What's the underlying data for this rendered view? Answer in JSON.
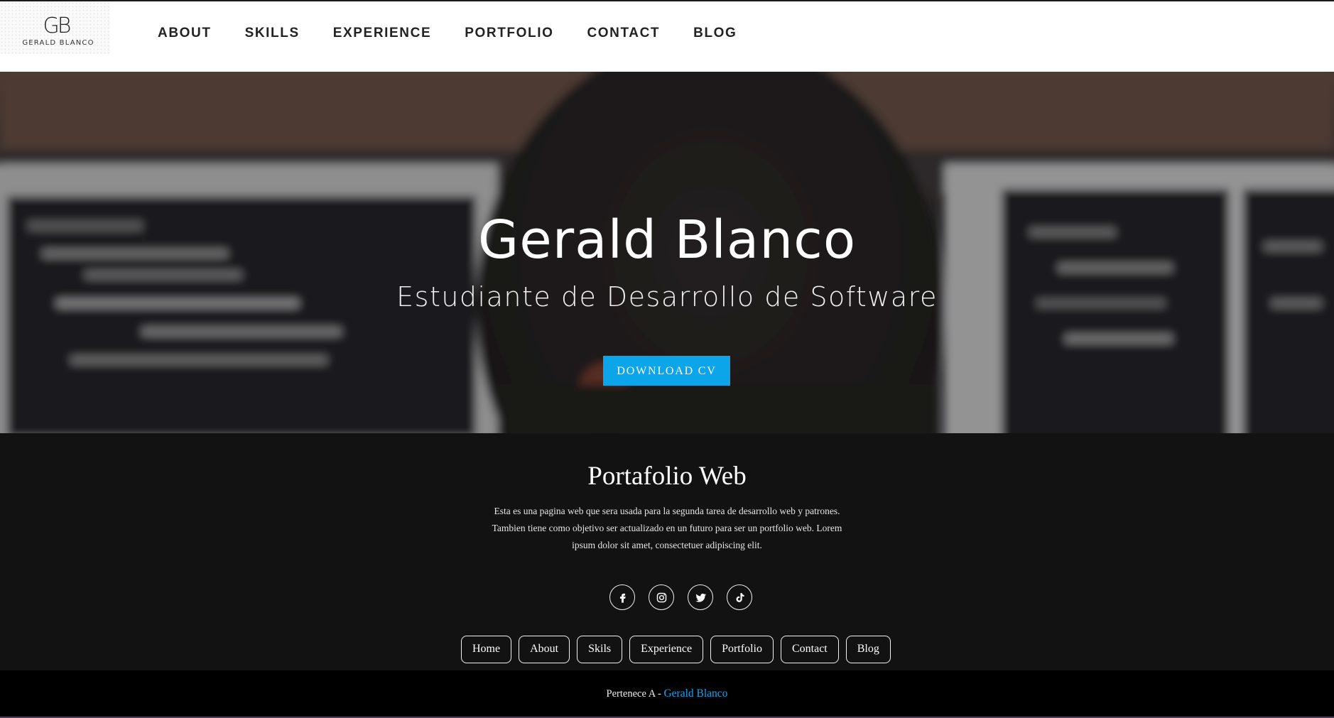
{
  "logo": {
    "mark": "GB",
    "name": "GERALD BLANCO"
  },
  "nav": {
    "items": [
      {
        "label": "ABOUT"
      },
      {
        "label": "SKILLS"
      },
      {
        "label": "EXPERIENCE"
      },
      {
        "label": "PORTFOLIO"
      },
      {
        "label": "CONTACT"
      },
      {
        "label": "BLOG"
      }
    ]
  },
  "hero": {
    "title": "Gerald Blanco",
    "subtitle": "Estudiante de Desarrollo de Software",
    "button_label": "DOWNLOAD CV"
  },
  "about": {
    "title": "Portafolio Web",
    "text": "Esta es una pagina web que sera usada para la segunda tarea de desarrollo web y patrones. Tambien tiene como objetivo ser actualizado en un futuro para ser un portfolio web. Lorem ipsum dolor sit amet, consectetuer adipiscing elit.",
    "social": [
      {
        "icon": "facebook-icon"
      },
      {
        "icon": "instagram-icon"
      },
      {
        "icon": "twitter-icon"
      },
      {
        "icon": "tiktok-icon"
      }
    ],
    "links": [
      {
        "label": "Home"
      },
      {
        "label": "About"
      },
      {
        "label": "Skils"
      },
      {
        "label": "Experience"
      },
      {
        "label": "Portfolio"
      },
      {
        "label": "Contact"
      },
      {
        "label": "Blog"
      }
    ]
  },
  "footer": {
    "prefix": "Pertenece A - ",
    "owner": "Gerald Blanco"
  },
  "colors": {
    "accent": "#0ca5e9",
    "link": "#1aa3ec",
    "section_bg": "#121212",
    "footer_bg": "#000000"
  }
}
